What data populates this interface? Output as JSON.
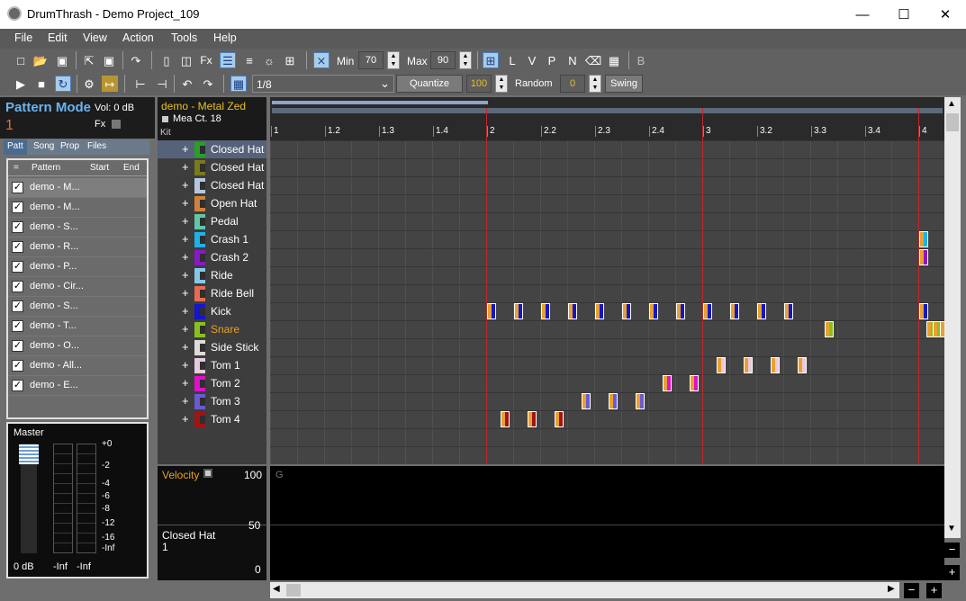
{
  "window": {
    "title": "DrumThrash - Demo Project_109",
    "minimize": "—",
    "maximize": "☐",
    "close": "✕"
  },
  "menu": [
    "File",
    "Edit",
    "View",
    "Action",
    "Tools",
    "Help"
  ],
  "toolbar": {
    "min_label": "Min",
    "min_value": "70",
    "max_label": "Max",
    "max_value": "90",
    "letters": [
      "L",
      "V",
      "P",
      "N",
      "B"
    ],
    "fx_label": "Fx",
    "grid_value": "1/8",
    "quantize_label": "Quantize",
    "quantize_value": "100",
    "random_label": "Random",
    "random_value": "0",
    "swing_label": "Swing"
  },
  "pattern_mode": {
    "title": "Pattern Mode",
    "vol": "Vol: 0 dB",
    "fx": "Fx",
    "number": "1"
  },
  "tabs": [
    "Patt",
    "Song",
    "Prop",
    "Files"
  ],
  "pattern_list": {
    "columns": [
      "=",
      "Pattern",
      "Start",
      "End"
    ],
    "rows": [
      "demo - M...",
      "demo - M...",
      "demo - S...",
      "demo - R...",
      "demo - P...",
      "demo - Cir...",
      "demo - S...",
      "demo - T...",
      "demo - O...",
      "demo - All...",
      "demo - E..."
    ]
  },
  "master": {
    "title": "Master",
    "vol": "0 dB",
    "left": "-Inf",
    "right": "-Inf",
    "scale": [
      "+0",
      "-2",
      "-4",
      "-6",
      "-8",
      "-12",
      "-16",
      "-Inf"
    ]
  },
  "kit": {
    "pattern_name": "demo - Metal Zed",
    "measure_count": "Mea Ct. 18",
    "label": "Kit",
    "instruments": [
      {
        "name": "Closed Hat",
        "color": "#2a9d2a"
      },
      {
        "name": "Closed Hat",
        "color": "#7a7a1e"
      },
      {
        "name": "Closed Hat",
        "color": "#b6c8de"
      },
      {
        "name": "Open Hat",
        "color": "#d2813a"
      },
      {
        "name": "Pedal",
        "color": "#62c6a8"
      },
      {
        "name": "Crash 1",
        "color": "#1eb2e8"
      },
      {
        "name": "Crash 2",
        "color": "#8a18c8"
      },
      {
        "name": "Ride",
        "color": "#86c8e8"
      },
      {
        "name": "Ride Bell",
        "color": "#e86a50"
      },
      {
        "name": "Kick",
        "color": "#1414d2"
      },
      {
        "name": "Snare",
        "color": "#88c01e"
      },
      {
        "name": "Side Stick",
        "color": "#dcdcdc"
      },
      {
        "name": "Tom 1",
        "color": "#e8cade"
      },
      {
        "name": "Tom 2",
        "color": "#e010c8"
      },
      {
        "name": "Tom 3",
        "color": "#6a5ad2"
      },
      {
        "name": "Tom 4",
        "color": "#a01414"
      }
    ]
  },
  "ruler": [
    "1",
    "1.2",
    "1.3",
    "1.4",
    "2",
    "2.2",
    "2.3",
    "2.4",
    "3",
    "3.2",
    "3.3",
    "3.4",
    "4"
  ],
  "velocity": {
    "label": "Velocity",
    "max": "100",
    "mid": "50",
    "min": "0",
    "instrument": "Closed Hat",
    "instrument_index": "1",
    "marker": "G"
  },
  "notes": [
    {
      "row": 5,
      "col": 24,
      "color": "#1eb2e8"
    },
    {
      "row": 6,
      "col": 24,
      "color": "#8a18c8"
    },
    {
      "row": 9,
      "col": 8,
      "color": "#1414d2"
    },
    {
      "row": 9,
      "col": 9,
      "color": "#1414d2"
    },
    {
      "row": 9,
      "col": 10,
      "color": "#1414d2"
    },
    {
      "row": 9,
      "col": 11,
      "color": "#1414d2"
    },
    {
      "row": 9,
      "col": 12,
      "color": "#1414d2"
    },
    {
      "row": 9,
      "col": 13,
      "color": "#1414d2"
    },
    {
      "row": 9,
      "col": 14,
      "color": "#1414d2"
    },
    {
      "row": 9,
      "col": 15,
      "color": "#1414d2"
    },
    {
      "row": 9,
      "col": 16,
      "color": "#1414d2"
    },
    {
      "row": 9,
      "col": 17,
      "color": "#1414d2"
    },
    {
      "row": 9,
      "col": 18,
      "color": "#1414d2"
    },
    {
      "row": 9,
      "col": 19,
      "color": "#1414d2"
    },
    {
      "row": 9,
      "col": 24,
      "color": "#1414d2"
    },
    {
      "row": 10,
      "col": 20.5,
      "color": "#88c01e"
    },
    {
      "row": 10,
      "col": 24.25,
      "color": "#88c01e"
    },
    {
      "row": 10,
      "col": 24.5,
      "color": "#88c01e"
    },
    {
      "row": 10,
      "col": 24.75,
      "color": "#88c01e"
    },
    {
      "row": 12,
      "col": 16.5,
      "color": "#e8cade"
    },
    {
      "row": 12,
      "col": 17.5,
      "color": "#e8cade"
    },
    {
      "row": 12,
      "col": 18.5,
      "color": "#e8cade"
    },
    {
      "row": 12,
      "col": 19.5,
      "color": "#e8cade"
    },
    {
      "row": 13,
      "col": 14.5,
      "color": "#e010c8"
    },
    {
      "row": 13,
      "col": 15.5,
      "color": "#e010c8"
    },
    {
      "row": 14,
      "col": 11.5,
      "color": "#6a5ad2"
    },
    {
      "row": 14,
      "col": 12.5,
      "color": "#6a5ad2"
    },
    {
      "row": 14,
      "col": 13.5,
      "color": "#6a5ad2"
    },
    {
      "row": 15,
      "col": 8.5,
      "color": "#a01414"
    },
    {
      "row": 15,
      "col": 9.5,
      "color": "#a01414"
    },
    {
      "row": 15,
      "col": 10.5,
      "color": "#a01414"
    }
  ]
}
